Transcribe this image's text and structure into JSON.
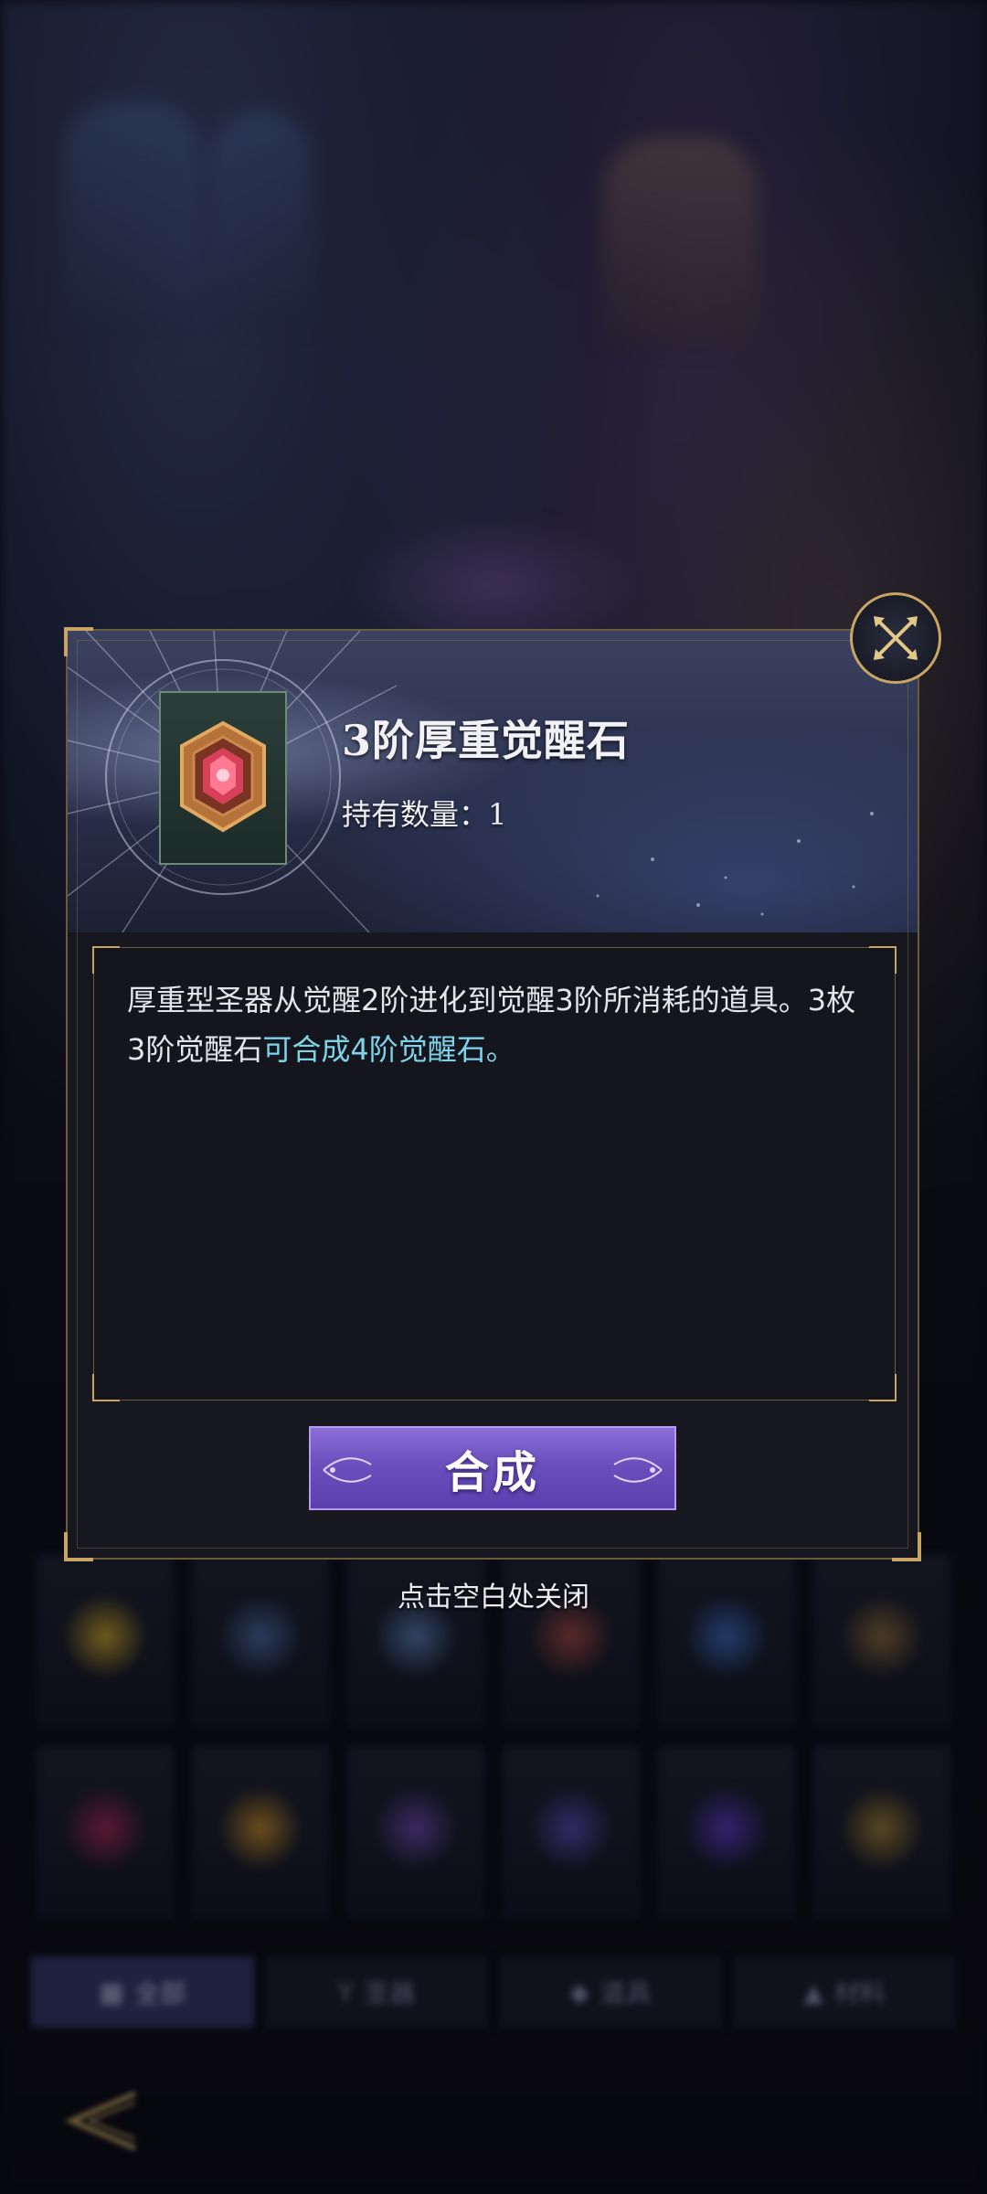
{
  "popup": {
    "item_name": "3阶厚重觉醒石",
    "count_label": "持有数量：",
    "count_value": "1",
    "description": {
      "part1": "厚重型圣器从觉醒2阶进化到觉醒3阶所消耗的道具。",
      "part2": "3枚3阶觉醒石",
      "part3": "可合成4阶觉醒石",
      "part4": "。"
    },
    "synthesize_label": "合成",
    "close_icon": "close-x-icon",
    "colors": {
      "highlight": "#7fd4e8",
      "button": "#6a4fbd",
      "frame_gold": "#c9a564"
    }
  },
  "hint": "点击空白处关闭",
  "background_tabs": [
    {
      "label": "全部",
      "icon": "grid-icon"
    },
    {
      "label": "圣器",
      "icon": "chalice-icon"
    },
    {
      "label": "道具",
      "icon": "stone-icon"
    },
    {
      "label": "材料",
      "icon": "triangle-icon"
    }
  ]
}
